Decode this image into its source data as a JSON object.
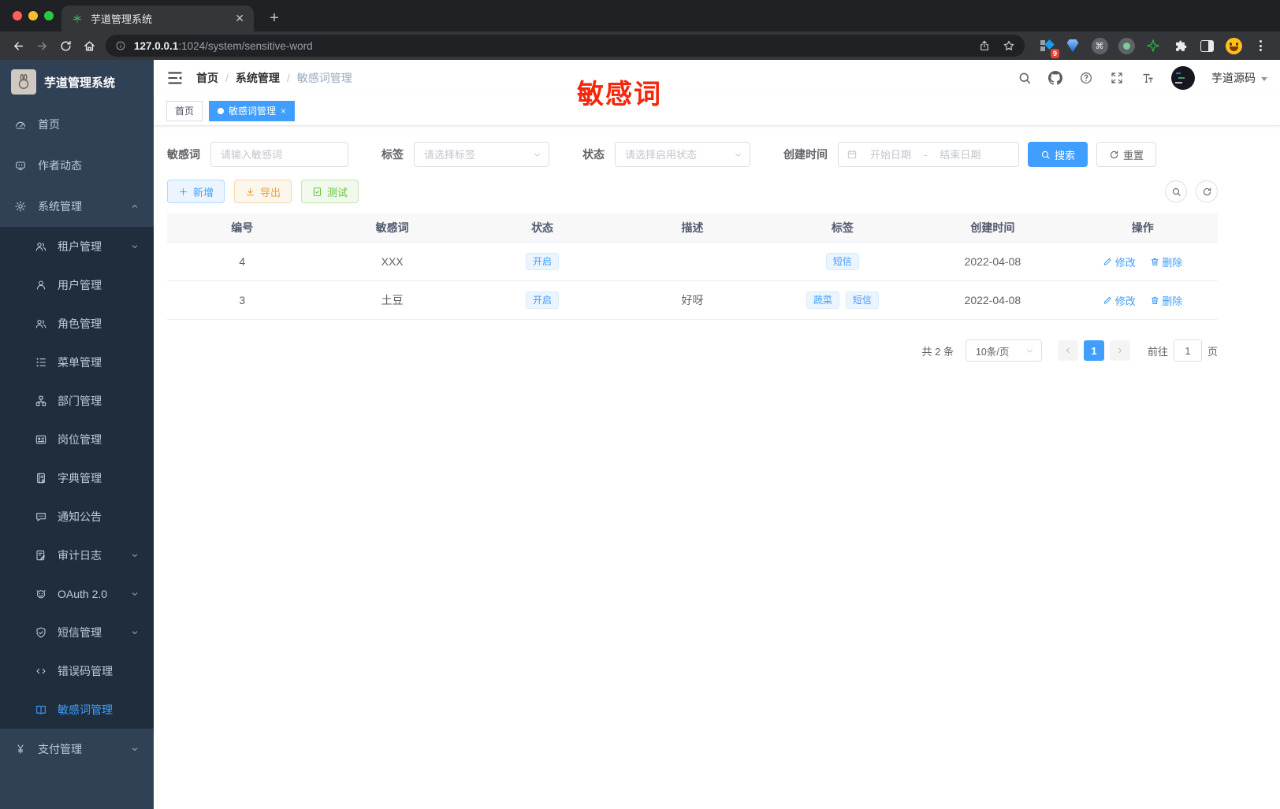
{
  "browser": {
    "tab_title": "芋道管理系统",
    "url_host": "127.0.0.1",
    "url_rest": ":1024/system/sensitive-word",
    "extension_badge": "9",
    "cmd_glyph": "⌘"
  },
  "sidebar": {
    "logo_title": "芋道管理系统",
    "home": "首页",
    "author": "作者动态",
    "system": "系统管理",
    "tenant": "租户管理",
    "user": "用户管理",
    "role": "角色管理",
    "menu": "菜单管理",
    "dept": "部门管理",
    "post": "岗位管理",
    "dict": "字典管理",
    "notice": "通知公告",
    "audit": "审计日志",
    "oauth": "OAuth 2.0",
    "sms": "短信管理",
    "errcode": "错误码管理",
    "sensitive": "敏感词管理",
    "pay": "支付管理"
  },
  "header": {
    "breadcrumb": [
      "首页",
      "系统管理",
      "敏感词管理"
    ],
    "annotation": "敏感词",
    "username": "芋道源码"
  },
  "tabsview": {
    "home": "首页",
    "active": "敏感词管理"
  },
  "filters": {
    "word_label": "敏感词",
    "word_placeholder": "请输入敏感词",
    "tag_label": "标签",
    "tag_placeholder": "请选择标签",
    "status_label": "状态",
    "status_placeholder": "请选择启用状态",
    "time_label": "创建时间",
    "start_placeholder": "开始日期",
    "range_separator": "-",
    "end_placeholder": "结束日期",
    "search_label": "搜索",
    "reset_label": "重置"
  },
  "toolbar": {
    "add_label": "新增",
    "export_label": "导出",
    "test_label": "测试"
  },
  "table": {
    "columns": [
      "编号",
      "敏感词",
      "状态",
      "描述",
      "标签",
      "创建时间",
      "操作"
    ],
    "edit_label": "修改",
    "delete_label": "删除",
    "rows": [
      {
        "no": "4",
        "word": "XXX",
        "status": "开启",
        "desc": "",
        "tags": [
          "短信"
        ],
        "created": "2022-04-08"
      },
      {
        "no": "3",
        "word": "土豆",
        "status": "开启",
        "desc": "好呀",
        "tags": [
          "蔬菜",
          "短信"
        ],
        "created": "2022-04-08"
      }
    ]
  },
  "pagination": {
    "total": "共 2 条",
    "page_size": "10条/页",
    "page": "1",
    "goto_label": "前往",
    "goto_value": "1",
    "unit_label": "页"
  },
  "colors": {
    "accent": "#409eff",
    "annotation_red": "#f7250c",
    "warning": "#e6a23c",
    "success": "#67c23a",
    "sidebar_bg": "#304156",
    "submenu_bg": "#1f2d3d"
  }
}
